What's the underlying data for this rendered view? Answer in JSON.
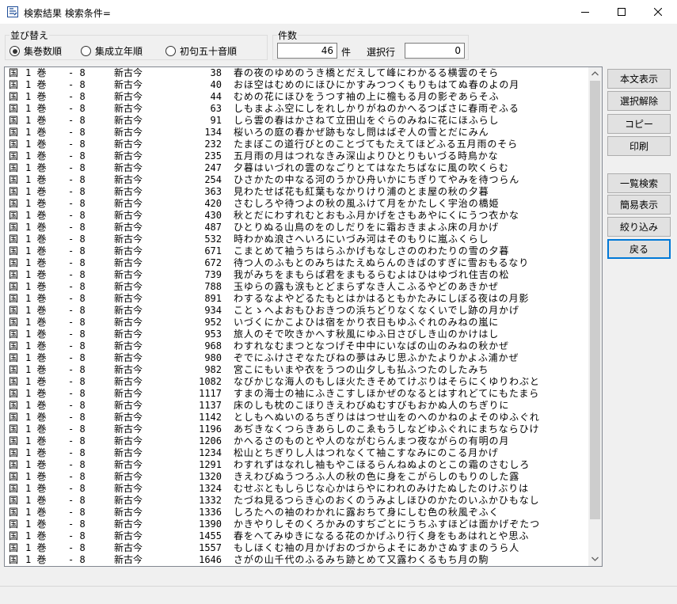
{
  "window": {
    "title": "検索結果 検索条件="
  },
  "sort": {
    "label": "並び替え",
    "options": [
      {
        "label": "集巻数順",
        "selected": true
      },
      {
        "label": "集成立年順",
        "selected": false
      },
      {
        "label": "初句五十音順",
        "selected": false
      }
    ]
  },
  "count": {
    "label": "件数",
    "value": "46",
    "unit": "件",
    "selected_label": "選択行",
    "selected_value": "0"
  },
  "buttons": {
    "show_text": "本文表示",
    "deselect": "選択解除",
    "copy": "コピー",
    "print": "印刷",
    "list_search": "一覧検索",
    "simple_view": "簡易表示",
    "narrow": "絞り込み",
    "back": "戻る"
  },
  "results": [
    {
      "kuni": "国",
      "kan": "1 巻",
      "sep": "-   8",
      "shu": "新古今",
      "no": "38",
      "poem": "春の夜のゆめのうき橋とだえして峰にわかるる横雲のそら"
    },
    {
      "kuni": "国",
      "kan": "1 巻",
      "sep": "-   8",
      "shu": "新古今",
      "no": "40",
      "poem": "おほ空はむめのにほひにかすみつつくもりもはてぬ春のよの月"
    },
    {
      "kuni": "国",
      "kan": "1 巻",
      "sep": "-   8",
      "shu": "新古今",
      "no": "44",
      "poem": "むめの花にほひをうつす袖の上に檐もる月の影ぞあらそふ"
    },
    {
      "kuni": "国",
      "kan": "1 巻",
      "sep": "-   8",
      "shu": "新古今",
      "no": "63",
      "poem": "しもまよふ空にしをれしかりがねのかへるつばさに春雨ぞふる"
    },
    {
      "kuni": "国",
      "kan": "1 巻",
      "sep": "-   8",
      "shu": "新古今",
      "no": "91",
      "poem": "しら雲の春はかさねて立田山をぐらのみねに花にほふらし"
    },
    {
      "kuni": "国",
      "kan": "1 巻",
      "sep": "-   8",
      "shu": "新古今",
      "no": "134",
      "poem": "桜いろの庭の春かぜ跡もなし問はばぞ人の雪とだにみん"
    },
    {
      "kuni": "国",
      "kan": "1 巻",
      "sep": "-   8",
      "shu": "新古今",
      "no": "232",
      "poem": "たまぼこの道行びとのことづてもたえてほどふる五月雨のそら"
    },
    {
      "kuni": "国",
      "kan": "1 巻",
      "sep": "-   8",
      "shu": "新古今",
      "no": "235",
      "poem": "五月雨の月はつれなきみ深山よりひとりもいづる時鳥かな"
    },
    {
      "kuni": "国",
      "kan": "1 巻",
      "sep": "-   8",
      "shu": "新古今",
      "no": "247",
      "poem": "夕暮はいづれの雲のなごりとてはなたちばなに風の吹くらむ"
    },
    {
      "kuni": "国",
      "kan": "1 巻",
      "sep": "-   8",
      "shu": "新古今",
      "no": "254",
      "poem": "ひさかたの中なる河のうかひ舟いかにちぎりてやみを待つらん"
    },
    {
      "kuni": "国",
      "kan": "1 巻",
      "sep": "-   8",
      "shu": "新古今",
      "no": "363",
      "poem": "見わたせば花も紅葉もなかりけり浦のとま屋の秋の夕暮"
    },
    {
      "kuni": "国",
      "kan": "1 巻",
      "sep": "-   8",
      "shu": "新古今",
      "no": "420",
      "poem": "さむしろや待つよの秋の風ふけて月をかたしく宇治の橋姫"
    },
    {
      "kuni": "国",
      "kan": "1 巻",
      "sep": "-   8",
      "shu": "新古今",
      "no": "430",
      "poem": "秋とだにわすれむとおもふ月かげをさもあやにくにうつ衣かな"
    },
    {
      "kuni": "国",
      "kan": "1 巻",
      "sep": "-   8",
      "shu": "新古今",
      "no": "487",
      "poem": "ひとりぬる山鳥のをのしだりをに霜おきまよふ床の月かげ"
    },
    {
      "kuni": "国",
      "kan": "1 巻",
      "sep": "-   8",
      "shu": "新古今",
      "no": "532",
      "poem": "時わかぬ浪さへいろにいづみ河はそのもりに嵐ふくらし"
    },
    {
      "kuni": "国",
      "kan": "1 巻",
      "sep": "-   8",
      "shu": "新古今",
      "no": "671",
      "poem": "こまとめて袖うちはらふかげもなしさののわたりの雪の夕暮"
    },
    {
      "kuni": "国",
      "kan": "1 巻",
      "sep": "-   8",
      "shu": "新古今",
      "no": "672",
      "poem": "待つ人のふもとのみちはたえぬらんのきばのすぎに雪おもるなり"
    },
    {
      "kuni": "国",
      "kan": "1 巻",
      "sep": "-   8",
      "shu": "新古今",
      "no": "739",
      "poem": "我がみちをまもらば君をまもるらむよはひはゆづれ住吉の松"
    },
    {
      "kuni": "国",
      "kan": "1 巻",
      "sep": "-   8",
      "shu": "新古今",
      "no": "788",
      "poem": "玉ゆらの露も涙もとどまらずなき人こふるやどのあきかぜ"
    },
    {
      "kuni": "国",
      "kan": "1 巻",
      "sep": "-   8",
      "shu": "新古今",
      "no": "891",
      "poem": "わするなよやどるたもとはかはるともかたみにしぼる夜はの月影"
    },
    {
      "kuni": "国",
      "kan": "1 巻",
      "sep": "-   8",
      "shu": "新古今",
      "no": "934",
      "poem": "ことゝへよおもひおきつの浜ちどりなくなくいでし跡の月かげ"
    },
    {
      "kuni": "国",
      "kan": "1 巻",
      "sep": "-   8",
      "shu": "新古今",
      "no": "952",
      "poem": "いづくにかこよひは宿をかり衣日もゆふぐれのみねの嵐に"
    },
    {
      "kuni": "国",
      "kan": "1 巻",
      "sep": "-   8",
      "shu": "新古今",
      "no": "953",
      "poem": "旅人のそで吹きかへす秋風にゆふ日さびしき山のかけはし"
    },
    {
      "kuni": "国",
      "kan": "1 巻",
      "sep": "-   8",
      "shu": "新古今",
      "no": "968",
      "poem": "わすれなむまつとなつげそ中中にいなばの山のみねの秋かぜ"
    },
    {
      "kuni": "国",
      "kan": "1 巻",
      "sep": "-   8",
      "shu": "新古今",
      "no": "980",
      "poem": "ぞでにふけさぞなたびねの夢はみじ思ふかたよりかよふ浦かぜ"
    },
    {
      "kuni": "国",
      "kan": "1 巻",
      "sep": "-   8",
      "shu": "新古今",
      "no": "982",
      "poem": "宮こにもいまや衣をうつの山夕しも払ふつたのしたみち"
    },
    {
      "kuni": "国",
      "kan": "1 巻",
      "sep": "-   8",
      "shu": "新古今",
      "no": "1082",
      "poem": "なびかじな海人のもしほ火たきそめてけぶりはそらにくゆりわぶと"
    },
    {
      "kuni": "国",
      "kan": "1 巻",
      "sep": "-   8",
      "shu": "新古今",
      "no": "1117",
      "poem": "すまの海士の袖にふきこすしほかぜのなるとはすれどてにもたまら"
    },
    {
      "kuni": "国",
      "kan": "1 巻",
      "sep": "-   8",
      "shu": "新古今",
      "no": "1137",
      "poem": "床のしも枕のこほりきえわびぬむすびもおかぬ人のちぎりに"
    },
    {
      "kuni": "国",
      "kan": "1 巻",
      "sep": "-   8",
      "shu": "新古今",
      "no": "1142",
      "poem": "としもへぬいのるちぎりははつせ山をのへのかねのよそのゆふぐれ"
    },
    {
      "kuni": "国",
      "kan": "1 巻",
      "sep": "-   8",
      "shu": "新古今",
      "no": "1196",
      "poem": "あぢきなくつらきあらしのこゑもうしなどゆふぐれにまちならひけ"
    },
    {
      "kuni": "国",
      "kan": "1 巻",
      "sep": "-   8",
      "shu": "新古今",
      "no": "1206",
      "poem": "かへるさのものとや人のながむらんまつ夜ながらの有明の月"
    },
    {
      "kuni": "国",
      "kan": "1 巻",
      "sep": "-   8",
      "shu": "新古今",
      "no": "1234",
      "poem": "松山とちぎりし人はつれなくて袖こすなみにのこる月かげ"
    },
    {
      "kuni": "国",
      "kan": "1 巻",
      "sep": "-   8",
      "shu": "新古今",
      "no": "1291",
      "poem": "わすれずはなれし袖もやこほるらんねぬよのとこの霜のさむしろ"
    },
    {
      "kuni": "国",
      "kan": "1 巻",
      "sep": "-   8",
      "shu": "新古今",
      "no": "1320",
      "poem": "きえわびぬうつろふ人の秋の色に身をこがらしのもりのした露"
    },
    {
      "kuni": "国",
      "kan": "1 巻",
      "sep": "-   8",
      "shu": "新古今",
      "no": "1324",
      "poem": "むせぶともしらじな心かはらやにわれのみけたぬしたのけぶりは"
    },
    {
      "kuni": "国",
      "kan": "1 巻",
      "sep": "-   8",
      "shu": "新古今",
      "no": "1332",
      "poem": "たづね見るつらき心のおくのうみよしほひのかたのいふかひもなし"
    },
    {
      "kuni": "国",
      "kan": "1 巻",
      "sep": "-   8",
      "shu": "新古今",
      "no": "1336",
      "poem": "しろたへの袖のわかれに露おちて身にしむ色の秋風ぞふく"
    },
    {
      "kuni": "国",
      "kan": "1 巻",
      "sep": "-   8",
      "shu": "新古今",
      "no": "1390",
      "poem": "かきやりしそのくろかみのすぢごとにうちふすほどは面かげぞたつ"
    },
    {
      "kuni": "国",
      "kan": "1 巻",
      "sep": "-   8",
      "shu": "新古今",
      "no": "1455",
      "poem": "春をへてみゆきになるる花のかげふり行く身をもあはれとや思ふ"
    },
    {
      "kuni": "国",
      "kan": "1 巻",
      "sep": "-   8",
      "shu": "新古今",
      "no": "1557",
      "poem": "もしほくむ袖の月かげおのづからよそにあかさぬすまのうら人"
    },
    {
      "kuni": "国",
      "kan": "1 巻",
      "sep": "-   8",
      "shu": "新古今",
      "no": "1646",
      "poem": "さがの山千代のふるみち跡とめて又露わくるもち月の駒"
    }
  ]
}
